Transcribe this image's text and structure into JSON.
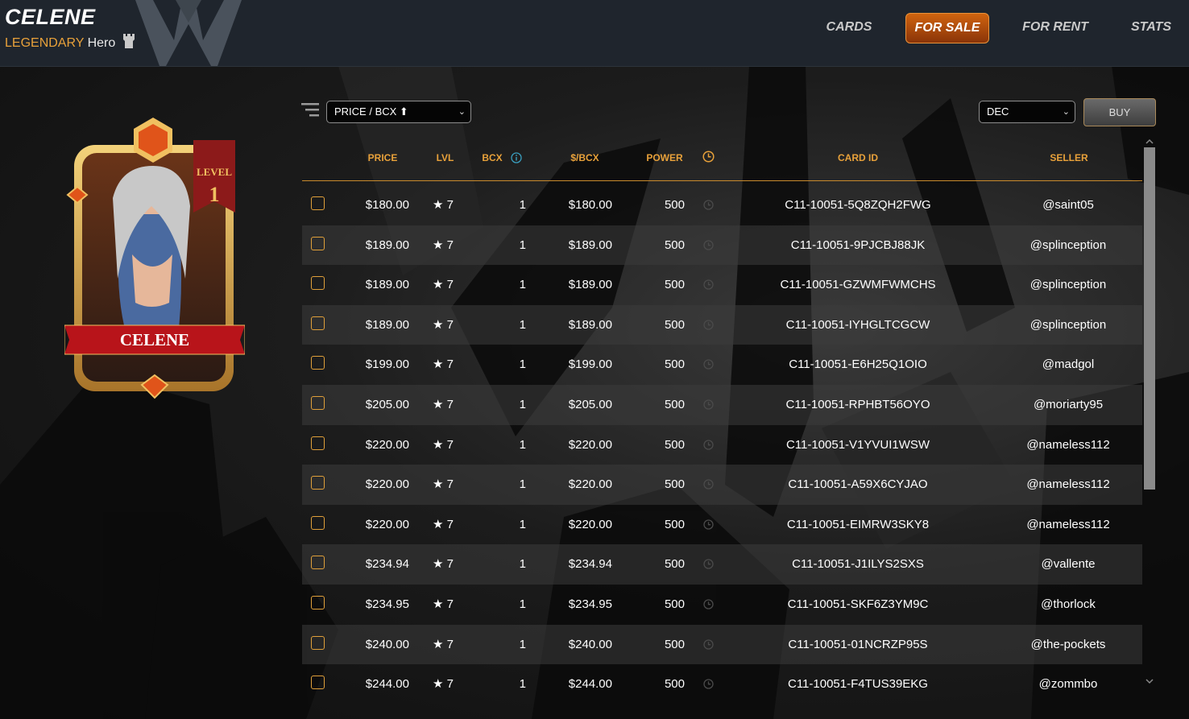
{
  "header": {
    "card_name": "CELENE",
    "rarity": "LEGENDARY",
    "card_type": "Hero",
    "nav": [
      {
        "label": "CARDS",
        "active": false
      },
      {
        "label": "FOR SALE",
        "active": true
      },
      {
        "label": "FOR RENT",
        "active": false
      },
      {
        "label": "STATS",
        "active": false
      }
    ]
  },
  "card_art": {
    "level_label": "LEVEL",
    "level_value": "1",
    "banner_name": "CELENE"
  },
  "toolbar": {
    "sort_value": "PRICE / BCX ⬆",
    "order_value": "DEC",
    "buy_label": "BUY"
  },
  "table": {
    "columns": [
      "PRICE",
      "LVL",
      "BCX",
      "$/BCX",
      "POWER",
      "CARD ID",
      "SELLER"
    ],
    "rows": [
      {
        "price": "$180.00",
        "lvl": "★ 7",
        "bcx": "1",
        "per_bcx": "$180.00",
        "power": "500",
        "card_id": "C11-10051-5Q8ZQH2FWG",
        "seller": "@saint05"
      },
      {
        "price": "$189.00",
        "lvl": "★ 7",
        "bcx": "1",
        "per_bcx": "$189.00",
        "power": "500",
        "card_id": "C11-10051-9PJCBJ88JK",
        "seller": "@splinception"
      },
      {
        "price": "$189.00",
        "lvl": "★ 7",
        "bcx": "1",
        "per_bcx": "$189.00",
        "power": "500",
        "card_id": "C11-10051-GZWMFWMCHS",
        "seller": "@splinception"
      },
      {
        "price": "$189.00",
        "lvl": "★ 7",
        "bcx": "1",
        "per_bcx": "$189.00",
        "power": "500",
        "card_id": "C11-10051-IYHGLTCGCW",
        "seller": "@splinception"
      },
      {
        "price": "$199.00",
        "lvl": "★ 7",
        "bcx": "1",
        "per_bcx": "$199.00",
        "power": "500",
        "card_id": "C11-10051-E6H25Q1OIO",
        "seller": "@madgol"
      },
      {
        "price": "$205.00",
        "lvl": "★ 7",
        "bcx": "1",
        "per_bcx": "$205.00",
        "power": "500",
        "card_id": "C11-10051-RPHBT56OYO",
        "seller": "@moriarty95"
      },
      {
        "price": "$220.00",
        "lvl": "★ 7",
        "bcx": "1",
        "per_bcx": "$220.00",
        "power": "500",
        "card_id": "C11-10051-V1YVUI1WSW",
        "seller": "@nameless112"
      },
      {
        "price": "$220.00",
        "lvl": "★ 7",
        "bcx": "1",
        "per_bcx": "$220.00",
        "power": "500",
        "card_id": "C11-10051-A59X6CYJAO",
        "seller": "@nameless112"
      },
      {
        "price": "$220.00",
        "lvl": "★ 7",
        "bcx": "1",
        "per_bcx": "$220.00",
        "power": "500",
        "card_id": "C11-10051-EIMRW3SKY8",
        "seller": "@nameless112"
      },
      {
        "price": "$234.94",
        "lvl": "★ 7",
        "bcx": "1",
        "per_bcx": "$234.94",
        "power": "500",
        "card_id": "C11-10051-J1ILYS2SXS",
        "seller": "@vallente"
      },
      {
        "price": "$234.95",
        "lvl": "★ 7",
        "bcx": "1",
        "per_bcx": "$234.95",
        "power": "500",
        "card_id": "C11-10051-SKF6Z3YM9C",
        "seller": "@thorlock"
      },
      {
        "price": "$240.00",
        "lvl": "★ 7",
        "bcx": "1",
        "per_bcx": "$240.00",
        "power": "500",
        "card_id": "C11-10051-01NCRZP95S",
        "seller": "@the-pockets"
      },
      {
        "price": "$244.00",
        "lvl": "★ 7",
        "bcx": "1",
        "per_bcx": "$244.00",
        "power": "500",
        "card_id": "C11-10051-F4TUS39EKG",
        "seller": "@zommbo"
      }
    ]
  },
  "colors": {
    "accent_orange": "#e8a13a",
    "header_bg": "#1f252d",
    "active_tab": "#b94c0c"
  },
  "icons": {
    "castle": "castle-icon",
    "helmet": "helmet-logo",
    "filter": "filter-icon",
    "info": "info-icon",
    "clock": "clock-icon"
  }
}
